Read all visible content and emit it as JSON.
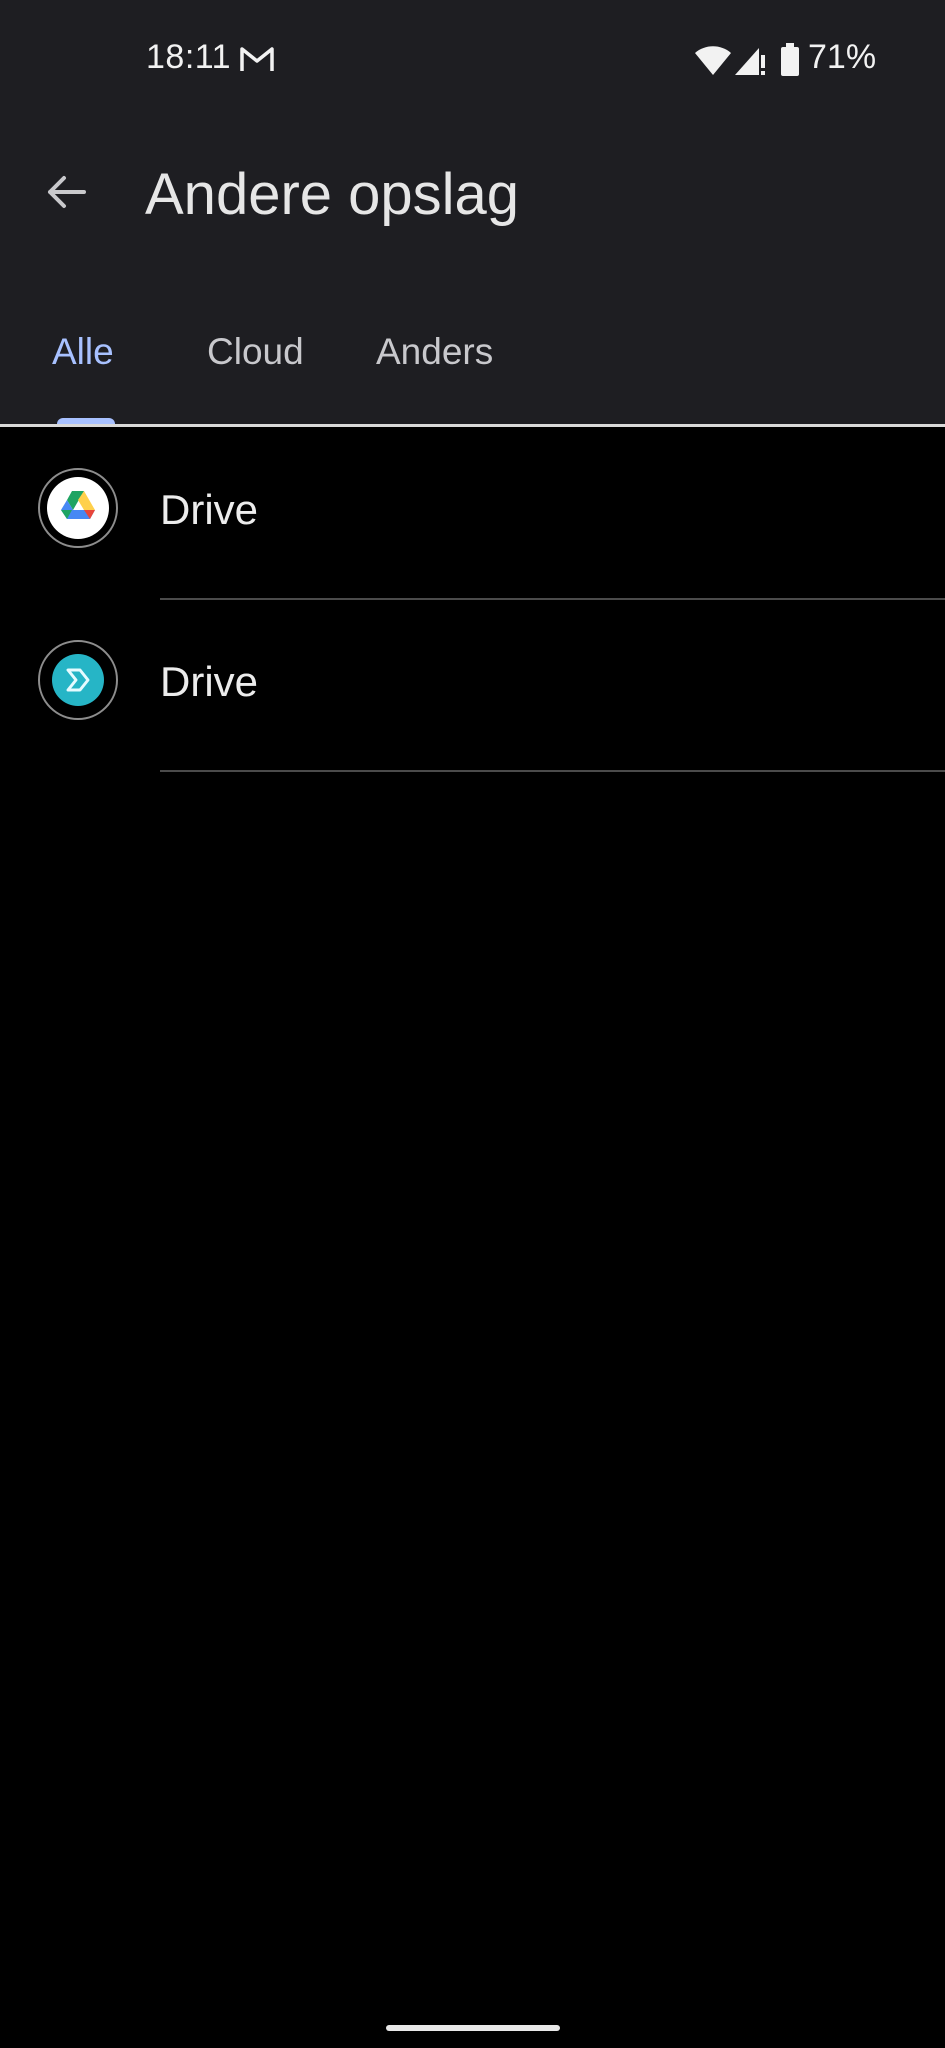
{
  "status_bar": {
    "time": "18:11",
    "battery_percent": "71%",
    "icons": [
      "gmail-icon",
      "wifi-icon",
      "signal-icon",
      "battery-icon"
    ]
  },
  "header": {
    "title": "Andere opslag",
    "back_icon": "arrow-left-icon"
  },
  "tabs": [
    {
      "label": "Alle",
      "active": true
    },
    {
      "label": "Cloud",
      "active": false
    },
    {
      "label": "Anders",
      "active": false
    }
  ],
  "list": [
    {
      "label": "Drive",
      "icon": "google-drive-icon"
    },
    {
      "label": "Drive",
      "icon": "teal-drive-icon"
    }
  ],
  "colors": {
    "accent": "#a8c1ff",
    "header_bg": "#1e1e22",
    "background": "#000000",
    "teal_icon": "#26b5c6"
  }
}
